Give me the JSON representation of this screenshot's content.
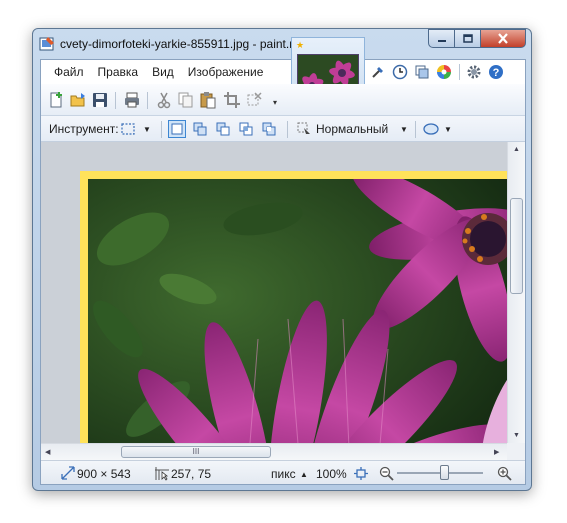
{
  "window": {
    "title": "cvety-dimorfoteki-yarkie-855911.jpg - paint.net версия ..."
  },
  "menu": {
    "items": [
      "Файл",
      "Правка",
      "Вид",
      "Изображение"
    ]
  },
  "toolbar": {
    "icons": [
      "new-file-icon",
      "open-file-icon",
      "save-icon",
      "print-icon",
      "cut-icon",
      "copy-icon",
      "paste-icon",
      "crop-icon",
      "deselect-icon"
    ]
  },
  "tool_options": {
    "label": "Инструмент:",
    "blend_mode": "Нормальный"
  },
  "statusbar": {
    "image_size": "900 × 543",
    "cursor_position": "257, 75",
    "units": "пикс",
    "zoom": "100%",
    "zoom_slider_fraction": 0.55
  },
  "scroll": {
    "h_thumb_grip": "III"
  },
  "colors": {
    "canvas_border": "#ffe25a",
    "window_frame": "#c9dbee",
    "close_button": "#c2402a",
    "flower": "#b8348c"
  }
}
